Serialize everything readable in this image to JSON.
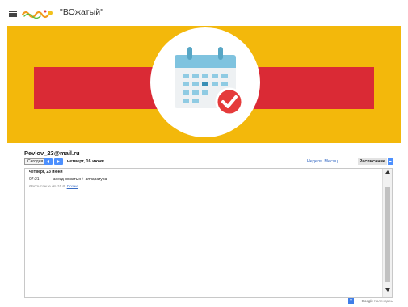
{
  "header": {
    "site_title": "\"ВОжатый\""
  },
  "colors": {
    "banner": "#f3b80b",
    "stripe": "#da2a35",
    "calendar_blue": "#7fc3df",
    "calendar_check": "#e53b3b",
    "link": "#3a6dc5"
  },
  "calendar": {
    "account": "Pevlov_23@mail.ru",
    "toolbar": {
      "today_label": "Сегодня",
      "date_label": "четверг, 16 июня",
      "week_label": "Неделя",
      "month_label": "Месяц",
      "schedule_label": "Расписание"
    },
    "day_header": "четверг, 23 июня",
    "event": {
      "time": "07:21",
      "title": "заезд вожатых + аппаратура"
    },
    "schedule_note": "Расписание до 15.8.",
    "schedule_link": "Позже",
    "footer": {
      "google_label": "Google",
      "calendar_label": "Календарь"
    }
  }
}
